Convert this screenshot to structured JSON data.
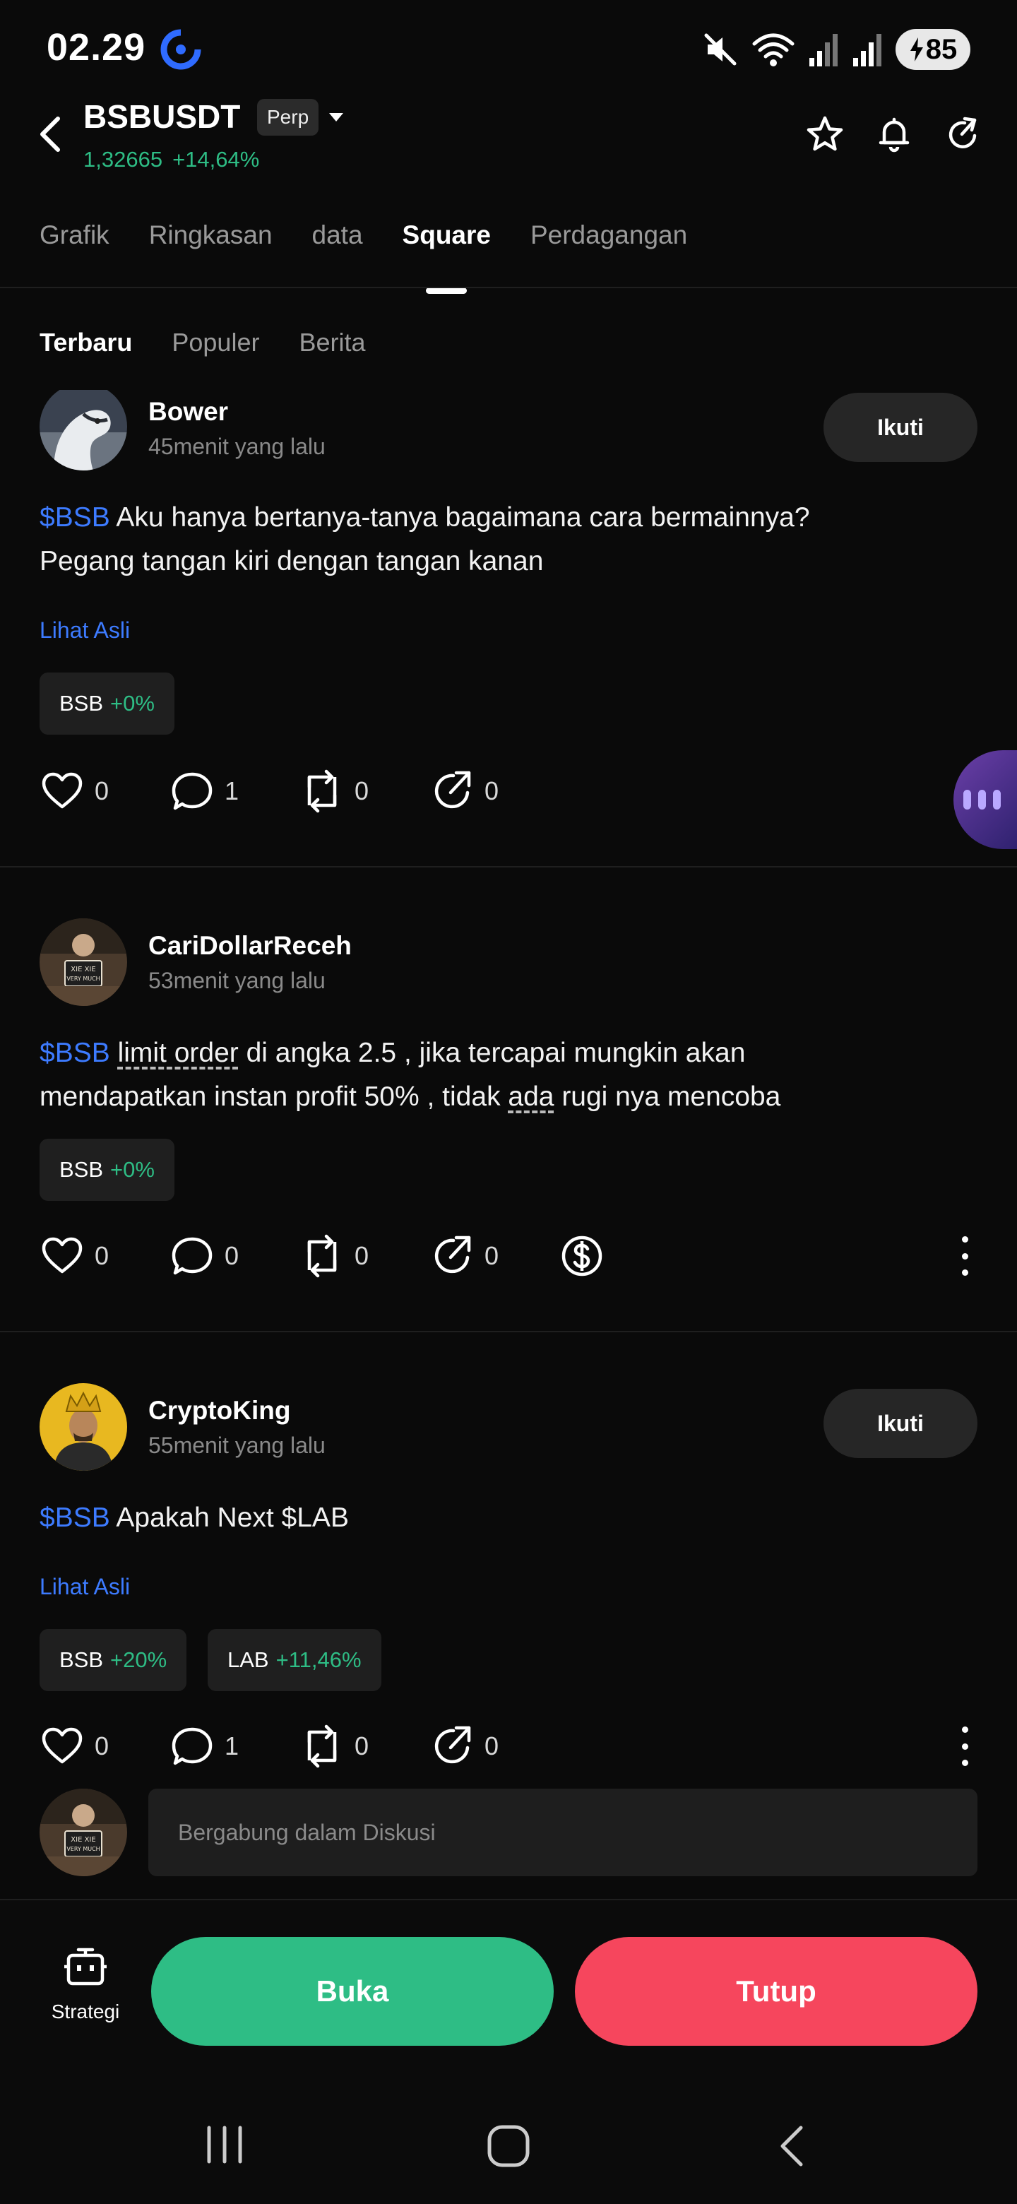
{
  "status_bar": {
    "time": "02.29",
    "battery": "85",
    "icons": [
      "app-icon",
      "mute-icon",
      "wifi-icon",
      "signal-icon",
      "signal-icon",
      "battery-charging-icon"
    ]
  },
  "header": {
    "pair": "BSBUSDT",
    "badge": "Perp",
    "price": "1,32665",
    "change": "+14,64%",
    "icons": [
      "back-icon",
      "caret-down-icon",
      "star-icon",
      "bell-icon",
      "share-icon"
    ]
  },
  "tabs": [
    {
      "label": "Grafik",
      "active": false
    },
    {
      "label": "Ringkasan",
      "active": false
    },
    {
      "label": "data",
      "active": false
    },
    {
      "label": "Square",
      "active": true
    },
    {
      "label": "Perdagangan",
      "active": false
    }
  ],
  "sub_tabs": [
    {
      "label": "Terbaru",
      "active": true
    },
    {
      "label": "Populer",
      "active": false
    },
    {
      "label": "Berita",
      "active": false
    }
  ],
  "posts": [
    {
      "username": "Bower",
      "time": "45menit yang lalu",
      "follow_label": "Ikuti",
      "tag": "$BSB",
      "text_line1": " Aku hanya bertanya-tanya bagaimana cara bermainnya?",
      "text_line2": "Pegang tangan kiri dengan tangan kanan",
      "link_label": "Lihat Asli",
      "chips": [
        {
          "symbol": "BSB",
          "change": "+0%"
        }
      ],
      "likes": "0",
      "comments": "1",
      "reposts": "0",
      "shares": "0"
    },
    {
      "username": "CariDollarReceh",
      "time": "53menit yang lalu",
      "tag": "$BSB",
      "text_pre": " ",
      "text_underlined1": "limit order",
      "text_mid": " di angka 2.5 , jika tercapai mungkin akan",
      "text_line2_pre": "mendapatkan instan profit 50% , tidak ",
      "text_underlined2": "ada",
      "text_line2_post": " rugi nya mencoba",
      "chips": [
        {
          "symbol": "BSB",
          "change": "+0%"
        }
      ],
      "likes": "0",
      "comments": "0",
      "reposts": "0",
      "shares": "0"
    },
    {
      "username": "CryptoKing",
      "time": "55menit yang lalu",
      "follow_label": "Ikuti",
      "tag": "$BSB",
      "text_line1": "  Apakah Next $LAB",
      "link_label": "Lihat Asli",
      "chips": [
        {
          "symbol": "BSB",
          "change": "+20%"
        },
        {
          "symbol": "LAB",
          "change": "+11,46%"
        }
      ],
      "likes": "0",
      "comments": "1",
      "reposts": "0",
      "shares": "0",
      "comment_placeholder": "Bergabung dalam Diskusi"
    }
  ],
  "bottom": {
    "strategy_label": "Strategi",
    "buy_label": "Buka",
    "sell_label": "Tutup"
  },
  "colors": {
    "background": "#0a0a0a",
    "positive": "#2ebd85",
    "negative": "#f6465d",
    "tag_blue": "#3d7bff"
  }
}
